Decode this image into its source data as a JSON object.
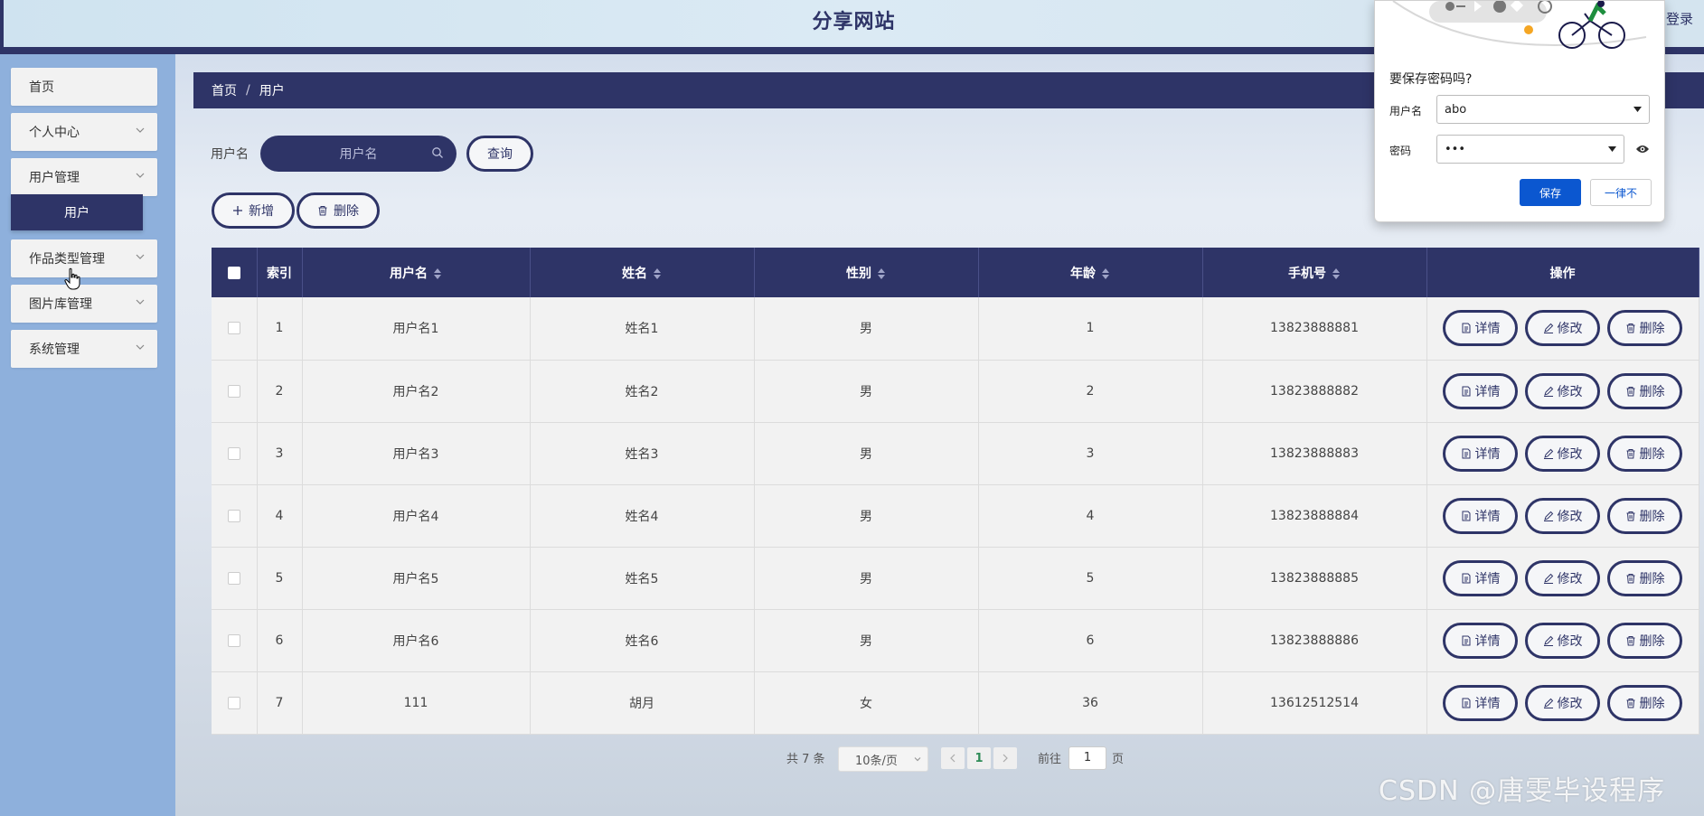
{
  "header": {
    "title": "分享网站",
    "login": "登录"
  },
  "sidebar": {
    "items": [
      {
        "label": "首页",
        "has_children": false
      },
      {
        "label": "个人中心",
        "has_children": true
      },
      {
        "label": "用户管理",
        "has_children": true,
        "expanded": true,
        "children": [
          {
            "label": "用户",
            "active": true
          }
        ]
      },
      {
        "label": "作品类型管理",
        "has_children": true
      },
      {
        "label": "图片库管理",
        "has_children": true
      },
      {
        "label": "系统管理",
        "has_children": true
      }
    ]
  },
  "breadcrumb": {
    "items": [
      "首页",
      "用户"
    ],
    "separator": "/"
  },
  "search": {
    "label": "用户名",
    "placeholder": "用户名",
    "query_button": "查询"
  },
  "toolbar": {
    "add": "新增",
    "delete": "删除"
  },
  "table": {
    "columns": [
      "",
      "索引",
      "用户名",
      "姓名",
      "性别",
      "年龄",
      "手机号",
      "操作"
    ],
    "rows": [
      {
        "index": "1",
        "username": "用户名1",
        "name": "姓名1",
        "gender": "男",
        "age": "1",
        "phone": "13823888881"
      },
      {
        "index": "2",
        "username": "用户名2",
        "name": "姓名2",
        "gender": "男",
        "age": "2",
        "phone": "13823888882"
      },
      {
        "index": "3",
        "username": "用户名3",
        "name": "姓名3",
        "gender": "男",
        "age": "3",
        "phone": "13823888883"
      },
      {
        "index": "4",
        "username": "用户名4",
        "name": "姓名4",
        "gender": "男",
        "age": "4",
        "phone": "13823888884"
      },
      {
        "index": "5",
        "username": "用户名5",
        "name": "姓名5",
        "gender": "男",
        "age": "5",
        "phone": "13823888885"
      },
      {
        "index": "6",
        "username": "用户名6",
        "name": "姓名6",
        "gender": "男",
        "age": "6",
        "phone": "13823888886"
      },
      {
        "index": "7",
        "username": "111",
        "name": "胡月",
        "gender": "女",
        "age": "36",
        "phone": "13612512514"
      }
    ],
    "row_actions": {
      "detail": "详情",
      "edit": "修改",
      "delete": "删除"
    }
  },
  "pagination": {
    "total": "共 7 条",
    "page_size": "10条/页",
    "current": "1",
    "goto_label": "前往",
    "goto_value": "1",
    "page_suffix": "页"
  },
  "password_popup": {
    "title": "要保存密码吗?",
    "username_label": "用户名",
    "username_value": "abo",
    "password_label": "密码",
    "password_value": "•••",
    "save_button": "保存",
    "never_button": "一律不"
  },
  "watermark": "CSDN @唐雯毕设程序",
  "colors": {
    "primary": "#2e3467",
    "sidebar_bg": "#8eb0dc",
    "save_blue": "#0b57d0"
  }
}
